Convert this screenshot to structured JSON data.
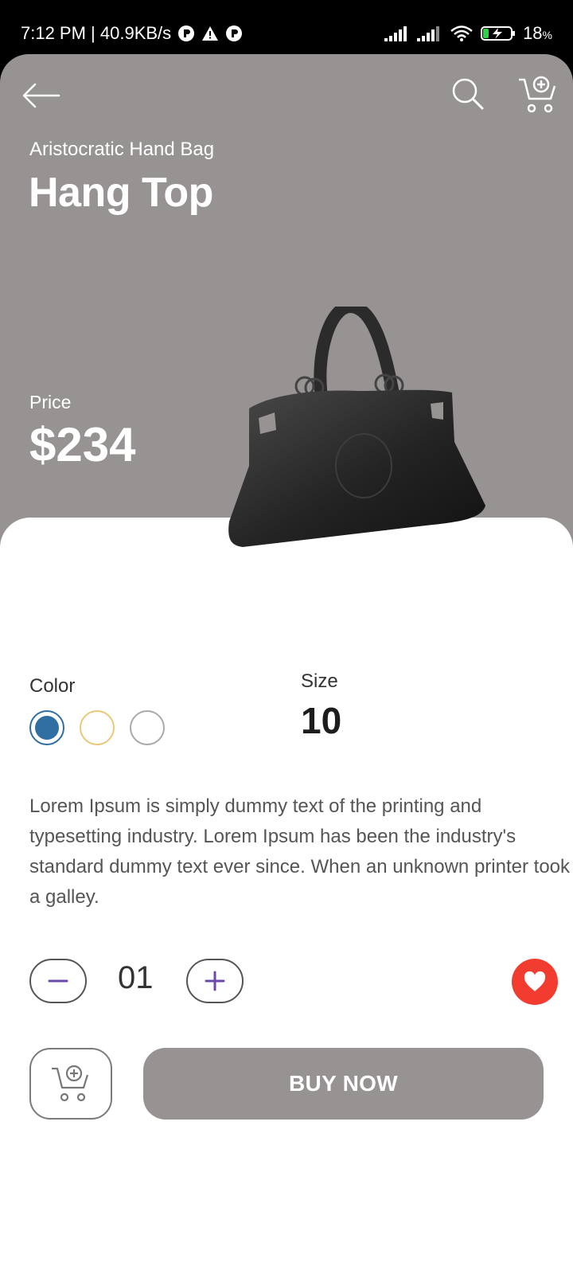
{
  "status_bar": {
    "time": "7:12 PM | 40.9KB/s",
    "battery": "18",
    "battery_unit": "%"
  },
  "header": {
    "subtitle": "Aristocratic Hand Bag",
    "title": "Hang Top",
    "price_label": "Price",
    "price_value": "$234"
  },
  "details": {
    "color_label": "Color",
    "colors": [
      "#316ea2",
      "#e8c879",
      "#a9a9a9"
    ],
    "selected_color": "#316ea2",
    "size_label": "Size",
    "size_value": "10",
    "description": "Lorem Ipsum is simply dummy text of the printing and typesetting industry. Lorem Ipsum has been the industry's standard dummy text ever since. When an unknown printer took a galley.",
    "quantity": "01",
    "buy_now_label": "BUY NOW"
  },
  "icons": [
    "back-arrow-icon",
    "search-icon",
    "add-cart-icon",
    "minus-icon",
    "plus-icon",
    "heart-icon"
  ],
  "colors": {
    "header_bg": "#979392",
    "accent_purple": "#6b49a8",
    "favorite_red": "#f23c2f"
  }
}
